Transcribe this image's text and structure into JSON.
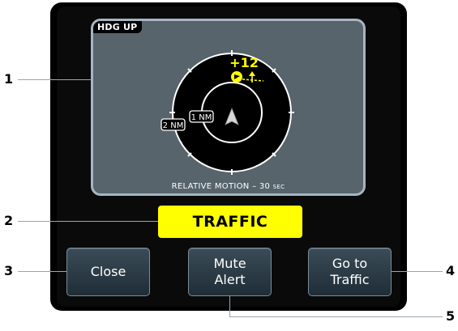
{
  "map": {
    "orientation_label": "HDG UP",
    "motion_caption": "RELATIVE MOTION – 30",
    "motion_caption_unit": "SEC",
    "outer_ring_label": "2 NM",
    "inner_ring_label": "1 NM",
    "traffic_relative_altitude": "+12"
  },
  "status": {
    "label": "TRAFFIC",
    "color": "#ffff00"
  },
  "buttons": {
    "close": "Close",
    "mute_line1": "Mute",
    "mute_line2": "Alert",
    "goto_line1": "Go to",
    "goto_line2": "Traffic"
  },
  "callouts": {
    "c1": "1",
    "c2": "2",
    "c3": "3",
    "c4": "4",
    "c5": "5"
  },
  "colors": {
    "traffic_alert": "#ffff00",
    "map_background": "#57646c",
    "frame_border": "#a7b5c0"
  },
  "icons": [
    "ownship-icon",
    "traffic-advisory-icon",
    "climbing-arrow-icon"
  ]
}
